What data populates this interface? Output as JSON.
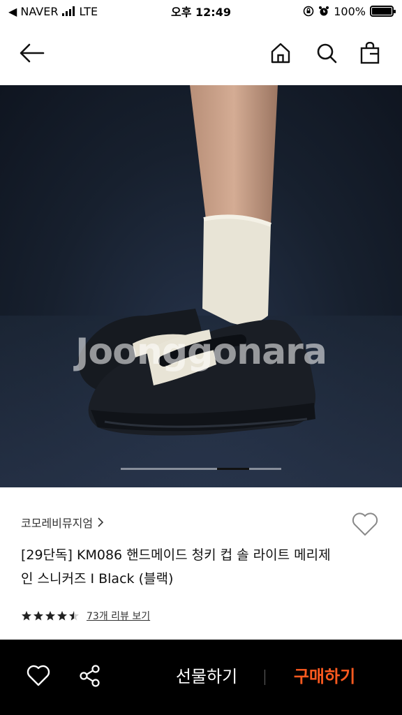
{
  "status_bar": {
    "back_app": "◀ NAVER",
    "network": "LTE",
    "time": "오후 12:49",
    "battery": "100%",
    "battery_level": 1.0
  },
  "nav": {
    "back_icon": "arrow-left-icon",
    "home_icon": "home-icon",
    "search_icon": "search-icon",
    "bag_icon": "shopping-bag-icon"
  },
  "hero": {
    "watermark": "Joonggonara",
    "image_count": 3,
    "active_index": 2
  },
  "product": {
    "brand": "코모레비뮤지엄",
    "title": "[29단독] KM086 핸드메이드 청키 컵 솔 라이트 메리제인 스니커즈 I Black (블랙)",
    "rating": 4.5,
    "review_link": "73개 리뷰 보기"
  },
  "bottom_bar": {
    "wish_icon": "heart-icon",
    "share_icon": "share-icon",
    "gift_label": "선물하기",
    "buy_label": "구매하기",
    "buy_color": "#ff5a1f"
  }
}
